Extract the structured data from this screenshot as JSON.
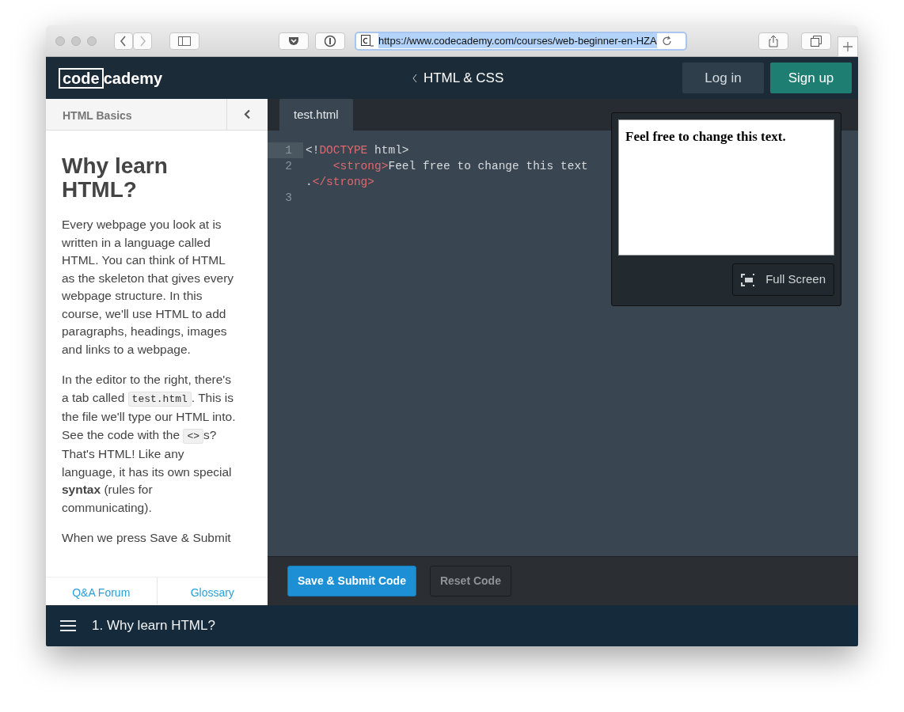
{
  "browser": {
    "url": "https://www.codecademy.com/courses/web-beginner-en-HZA",
    "url_selected": true
  },
  "header": {
    "logo_left": "code",
    "logo_right": "cademy",
    "course": "HTML & CSS",
    "buttons": [
      {
        "label": "Log in",
        "kind": "secondary"
      },
      {
        "label": "Sign up",
        "kind": "primary"
      }
    ]
  },
  "lesson_panel": {
    "unit": "HTML Basics",
    "title": "Why learn HTML?",
    "paragraphs": [
      [
        {
          "kind": "text",
          "text": "Every webpage you look at is written in a language called HTML. You can think of HTML as the skeleton that gives every webpage structure. In this course, we'll use HTML to add paragraphs, headings, images and links to a webpage."
        }
      ],
      [
        {
          "kind": "text",
          "text": "In the editor to the right, there's a tab called "
        },
        {
          "kind": "code",
          "text": "test.html"
        },
        {
          "kind": "text",
          "text": ". This is the file we'll type our HTML into. See the code with the "
        },
        {
          "kind": "code",
          "text": "<>"
        },
        {
          "kind": "text",
          "text": "s? That's HTML! Like any language, it has its own special "
        },
        {
          "kind": "bold",
          "text": "syntax"
        },
        {
          "kind": "text",
          "text": " (rules for communicating)."
        }
      ],
      [
        {
          "kind": "text",
          "text": "When we press Save & Submit"
        }
      ]
    ],
    "footer_links": [
      "Q&A Forum",
      "Glossary"
    ]
  },
  "editor": {
    "tabs": [
      {
        "label": "test.html",
        "selected": true
      }
    ],
    "lines": [
      {
        "number": "1",
        "active": true,
        "rows": [
          [
            {
              "kind": "punct",
              "text": "<!"
            },
            {
              "kind": "tag",
              "text": "DOCTYPE"
            },
            {
              "kind": "punct",
              "text": " html>"
            }
          ]
        ]
      },
      {
        "number": "2",
        "active": false,
        "rows": [
          [
            {
              "kind": "punct",
              "text": "    "
            },
            {
              "kind": "tag",
              "text": "<strong>"
            },
            {
              "kind": "punct",
              "text": "Feel free to change this text"
            }
          ],
          [
            {
              "kind": "punct",
              "text": "."
            },
            {
              "kind": "tag",
              "text": "</strong>"
            }
          ]
        ]
      },
      {
        "number": "3",
        "active": false,
        "rows": [
          []
        ]
      }
    ]
  },
  "preview": {
    "text": "Feel free to change this text.",
    "button": "Full Screen"
  },
  "actions": [
    {
      "label": "Save & Submit Code",
      "kind": "primary"
    },
    {
      "label": "Reset Code",
      "kind": "secondary"
    }
  ],
  "bottom_bar": {
    "lesson": "1. Why learn HTML?"
  }
}
